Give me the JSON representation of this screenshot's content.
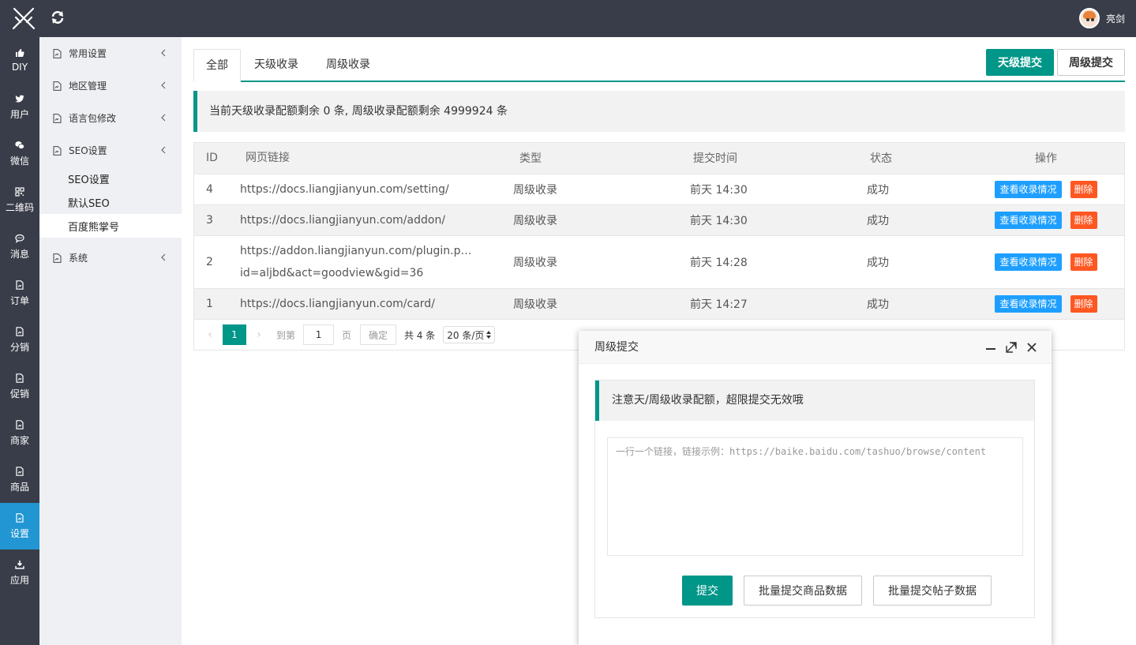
{
  "header": {
    "user_name": "亮剑"
  },
  "rail": [
    {
      "label": "DIY",
      "icon": "thumbs-up-icon"
    },
    {
      "label": "用户",
      "icon": "twitter-bird-icon"
    },
    {
      "label": "微信",
      "icon": "wechat-icon"
    },
    {
      "label": "二维码",
      "icon": "qrcode-icon"
    },
    {
      "label": "消息",
      "icon": "chat-bubble-icon"
    },
    {
      "label": "订单",
      "icon": "document-icon"
    },
    {
      "label": "分销",
      "icon": "document-icon"
    },
    {
      "label": "促销",
      "icon": "document-icon"
    },
    {
      "label": "商家",
      "icon": "document-icon"
    },
    {
      "label": "商品",
      "icon": "document-icon"
    },
    {
      "label": "设置",
      "icon": "document-icon",
      "active": true
    },
    {
      "label": "应用",
      "icon": "download-icon"
    }
  ],
  "sidebar": {
    "groups": [
      {
        "label": "常用设置"
      },
      {
        "label": "地区管理"
      },
      {
        "label": "语言包修改"
      },
      {
        "label": "SEO设置"
      },
      {
        "label": "系统"
      }
    ],
    "seo_items": [
      {
        "label": "SEO设置"
      },
      {
        "label": "默认SEO"
      },
      {
        "label": "百度熊掌号",
        "active": true
      }
    ]
  },
  "tabs": [
    "全部",
    "天级收录",
    "周级收录"
  ],
  "actions": {
    "day_submit": "天级提交",
    "week_submit": "周级提交"
  },
  "notice": "当前天级收录配额剩余 0 条, 周级收录配额剩余 4999924 条",
  "table": {
    "headers": {
      "id": "ID",
      "url": "网页链接",
      "type": "类型",
      "time": "提交时间",
      "state": "状态",
      "ops": "操作"
    },
    "rows": [
      {
        "id": "4",
        "url": "https://docs.liangjianyun.com/setting/",
        "url2": "",
        "type": "周级收录",
        "time": "前天 14:30",
        "state": "成功"
      },
      {
        "id": "3",
        "url": "https://docs.liangjianyun.com/addon/",
        "url2": "",
        "type": "周级收录",
        "time": "前天 14:30",
        "state": "成功"
      },
      {
        "id": "2",
        "url": "https://addon.liangjianyun.com/plugin.p…",
        "url2": "id=aljbd&act=goodview&gid=36",
        "type": "周级收录",
        "time": "前天 14:28",
        "state": "成功"
      },
      {
        "id": "1",
        "url": "https://docs.liangjianyun.com/card/",
        "url2": "",
        "type": "周级收录",
        "time": "前天 14:27",
        "state": "成功"
      }
    ],
    "view_label": "查看收录情况",
    "delete_label": "删除"
  },
  "pager": {
    "current": "1",
    "goto_label": "到第",
    "goto_value": "1",
    "page_label": "页",
    "confirm_label": "确定",
    "total_label": "共 4 条",
    "page_size": "20 条/页"
  },
  "dialog": {
    "title": "周级提交",
    "notice": "注意天/周级收录配额，超限提交无效哦",
    "placeholder": "一行一个链接，链接示例：https://baike.baidu.com/tashuo/browse/content",
    "submit_label": "提交",
    "batch_goods_label": "批量提交商品数据",
    "batch_posts_label": "批量提交帖子数据"
  },
  "colors": {
    "accent": "#009688",
    "blue": "#1e9fff",
    "danger": "#ff5722",
    "dark": "#393d49",
    "rail_active": "#2196d3"
  }
}
